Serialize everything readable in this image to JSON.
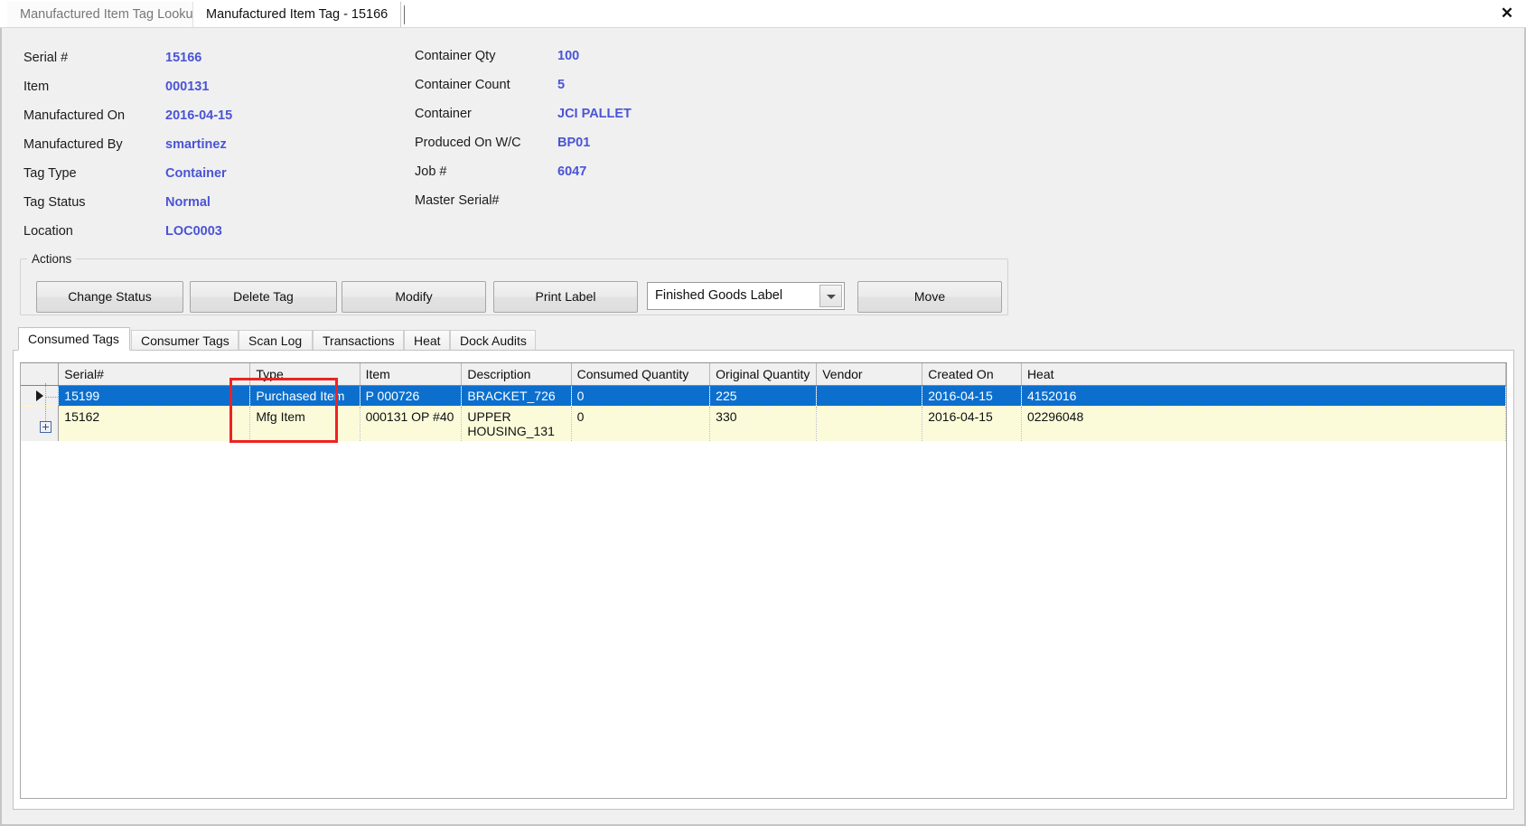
{
  "window": {
    "close_label": "✕"
  },
  "doc_tabs": [
    {
      "label": "Manufactured Item Tag Lookup",
      "active": false
    },
    {
      "label": "Manufactured Item Tag - 15166",
      "active": true
    }
  ],
  "header_fields": {
    "left": [
      {
        "label": "Serial #",
        "value": "15166"
      },
      {
        "label": "Item",
        "value": "000131"
      },
      {
        "label": "Manufactured On",
        "value": "2016-04-15"
      },
      {
        "label": "Manufactured By",
        "value": "smartinez"
      },
      {
        "label": "Tag Type",
        "value": "Container"
      },
      {
        "label": "Tag Status",
        "value": "Normal"
      },
      {
        "label": "Location",
        "value": "LOC0003"
      }
    ],
    "right": [
      {
        "label": "Container Qty",
        "value": "100"
      },
      {
        "label": "Container Count",
        "value": "5"
      },
      {
        "label": "Container",
        "value": "JCI PALLET"
      },
      {
        "label": "Produced On W/C",
        "value": "BP01"
      },
      {
        "label": "Job #",
        "value": "6047"
      },
      {
        "label": "Master Serial#",
        "value": ""
      }
    ]
  },
  "actions": {
    "title": "Actions",
    "buttons": [
      {
        "label": "Change Status"
      },
      {
        "label": "Delete Tag"
      },
      {
        "label": "Modify"
      },
      {
        "label": "Print Label"
      },
      {
        "label": "Move"
      }
    ],
    "label_select": {
      "selected": "Finished Goods Label",
      "options": [
        "Finished Goods Label"
      ]
    }
  },
  "lower_tabs": [
    {
      "label": "Consumed Tags",
      "selected": true
    },
    {
      "label": "Consumer Tags",
      "selected": false
    },
    {
      "label": "Scan Log",
      "selected": false
    },
    {
      "label": "Transactions",
      "selected": false
    },
    {
      "label": "Heat",
      "selected": false
    },
    {
      "label": "Dock Audits",
      "selected": false
    }
  ],
  "grid": {
    "columns": [
      "Serial#",
      "Type",
      "Item",
      "Description",
      "Consumed Quantity",
      "Original Quantity",
      "Vendor",
      "Created On",
      "Heat"
    ],
    "rows": [
      {
        "selected": true,
        "indicator": "row-selector-caret",
        "cells": {
          "serial": "15199",
          "type": "Purchased Item",
          "item": "P 000726",
          "description": "BRACKET_726",
          "consumed_quantity": "0",
          "original_quantity": "225",
          "vendor": "",
          "created_on": "2016-04-15",
          "heat": "4152016"
        }
      },
      {
        "selected": false,
        "indicator": "expander-plus",
        "cells": {
          "serial": "15162",
          "type": "Mfg Item",
          "item": "000131 OP #40",
          "description": "UPPER HOUSING_131",
          "consumed_quantity": "0",
          "original_quantity": "330",
          "vendor": "",
          "created_on": "2016-04-15",
          "heat": "02296048"
        }
      }
    ]
  },
  "annotation": {
    "kind": "red-highlight-rectangle",
    "target": "Type column"
  },
  "colors": {
    "value_blue": "#4a54d6",
    "selection_blue": "#0c6fce",
    "alt_row_yellow": "#fbfbda",
    "annotation_red": "#ee2222",
    "window_gray": "#f0f0f0"
  }
}
